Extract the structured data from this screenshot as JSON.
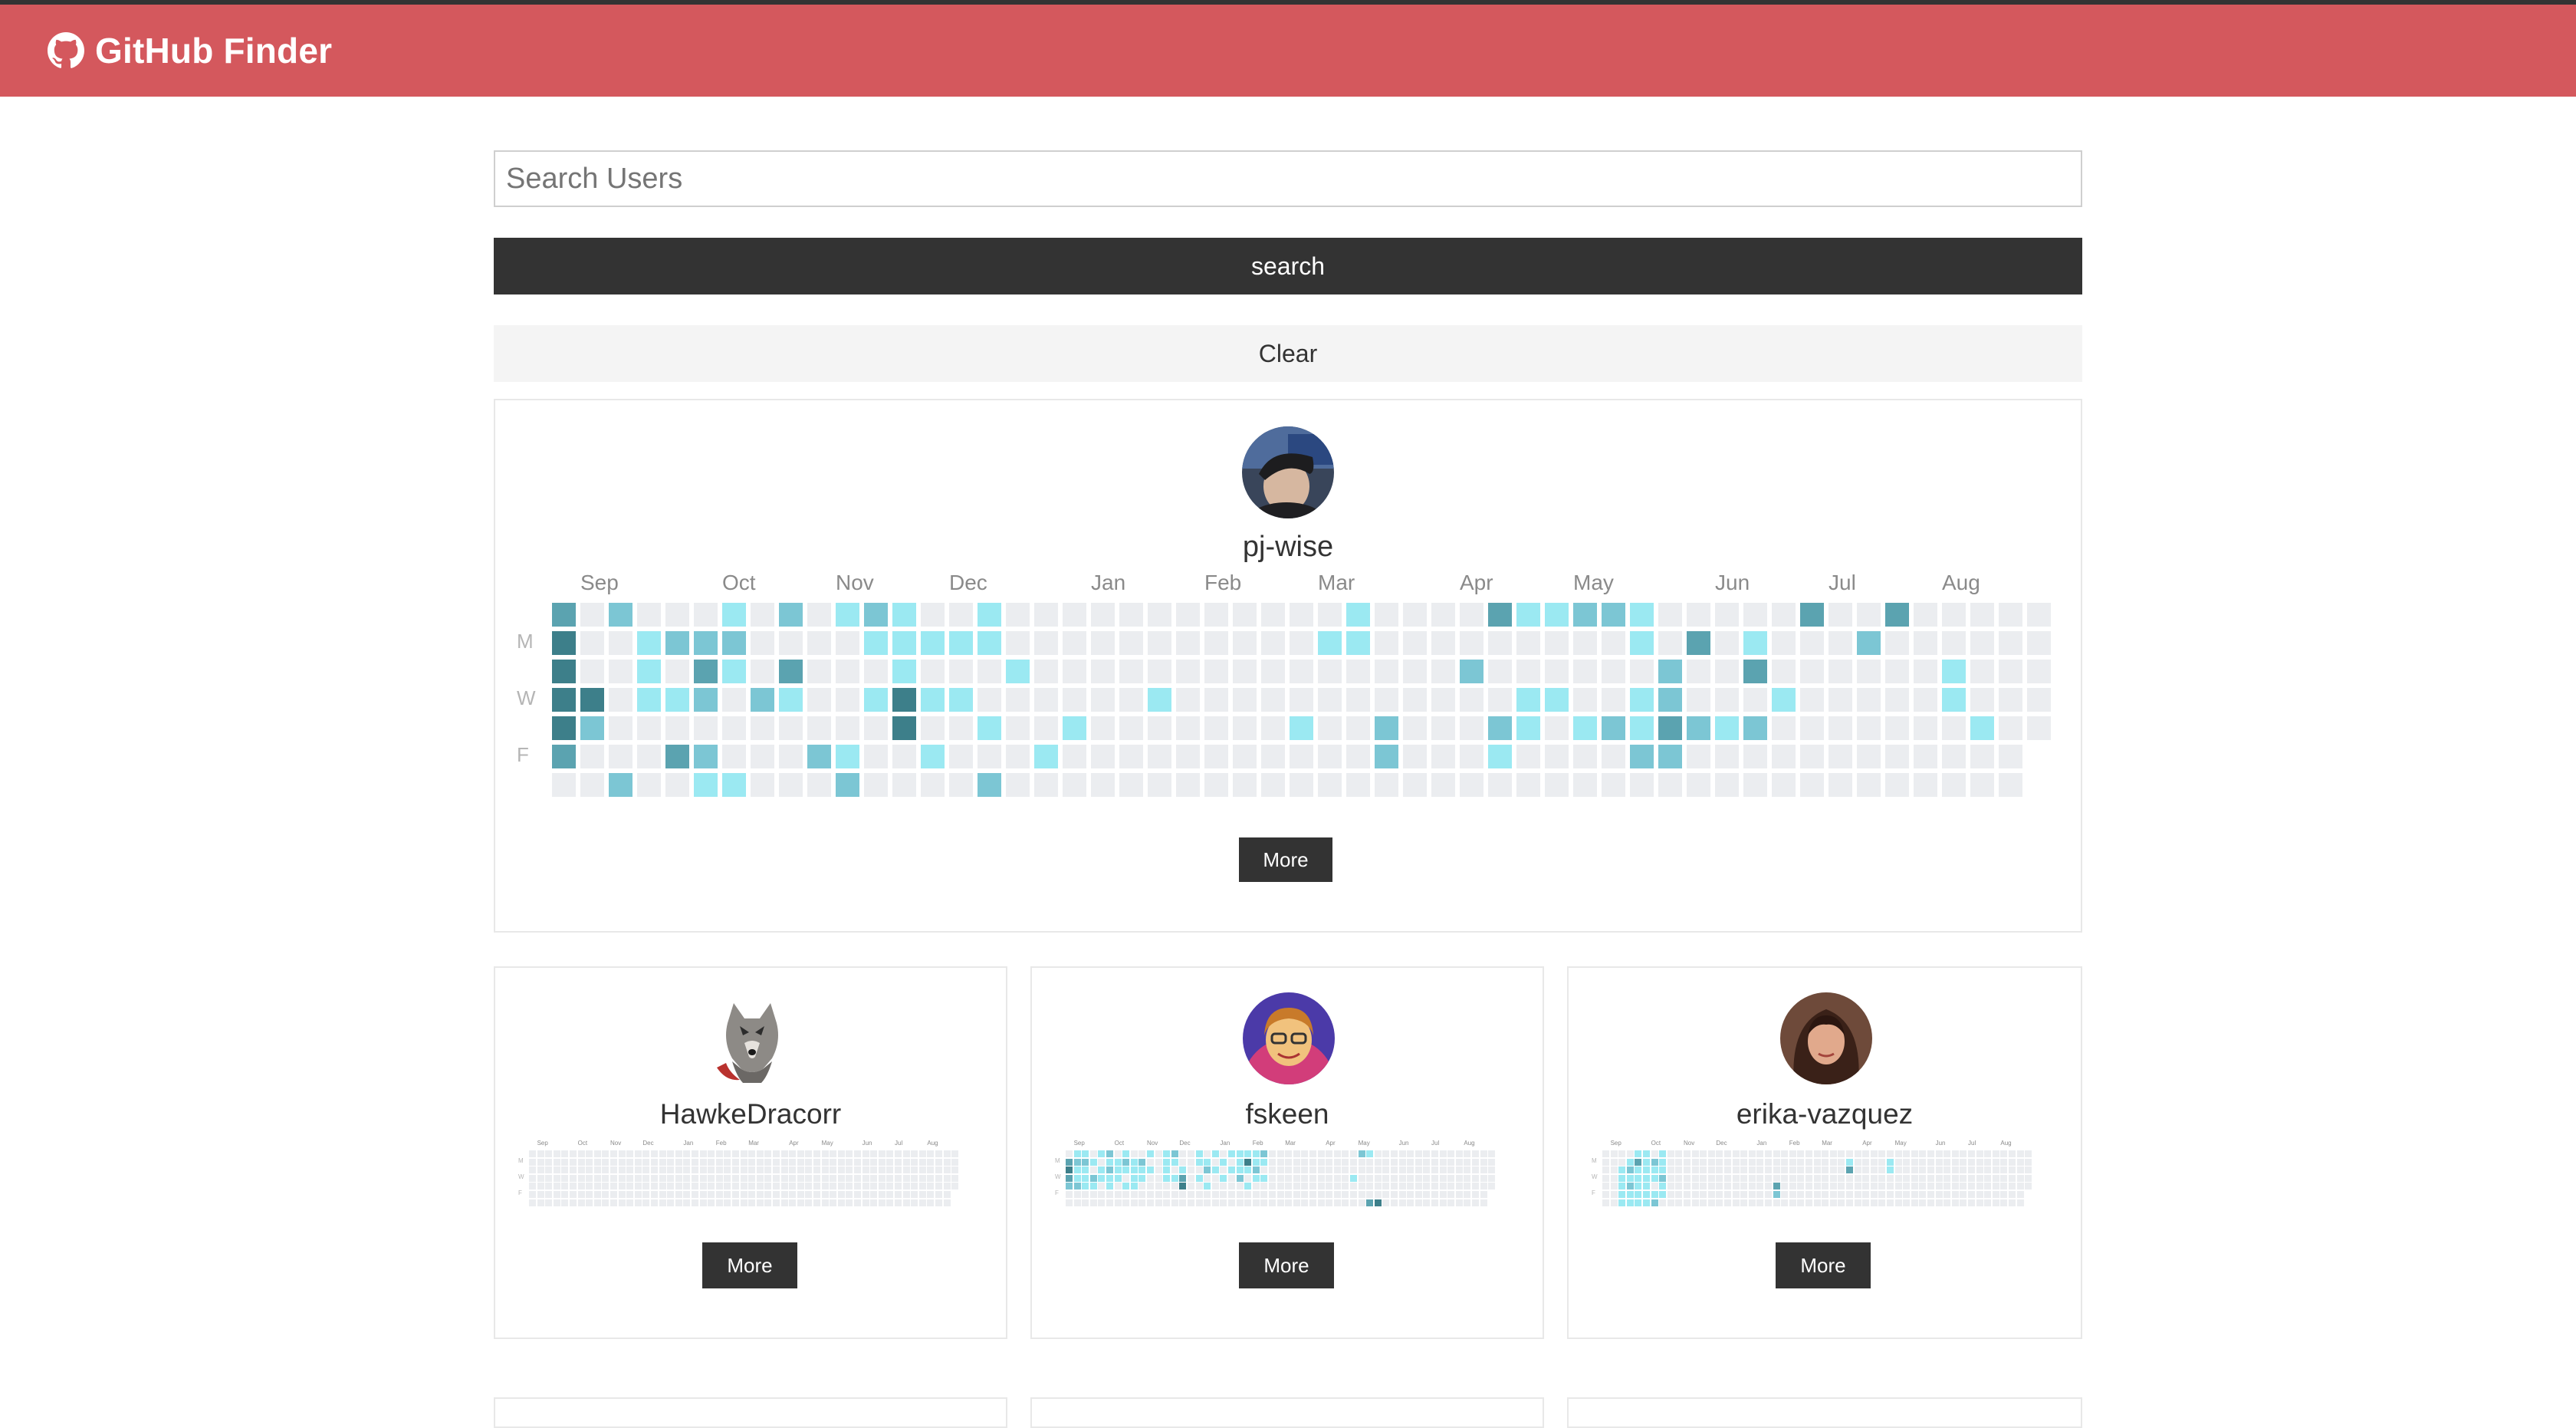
{
  "app": {
    "title": "GitHub Finder",
    "logo_icon": "github-icon",
    "accent": "#d4585d"
  },
  "search": {
    "placeholder": "Search Users",
    "value": "",
    "button_label": "search",
    "clear_label": "Clear"
  },
  "colors": {
    "l0": "#ebedf0",
    "l1": "#9be9f2",
    "l2": "#7cc6d4",
    "l3": "#5ba3b0",
    "l4": "#3d7f8a"
  },
  "day_labels": [
    "M",
    "W",
    "F"
  ],
  "months": [
    "Sep",
    "Oct",
    "Nov",
    "Dec",
    "Jan",
    "Feb",
    "Mar",
    "Apr",
    "May",
    "Jun",
    "Jul",
    "Aug"
  ],
  "featured": {
    "username": "pj-wise",
    "more_label": "More",
    "contributions": {
      "weeks": 53,
      "active": [
        [
          0,
          0,
          3
        ],
        [
          0,
          1,
          4
        ],
        [
          0,
          2,
          4
        ],
        [
          0,
          3,
          4
        ],
        [
          0,
          4,
          4
        ],
        [
          0,
          5,
          3
        ],
        [
          1,
          3,
          4
        ],
        [
          1,
          4,
          2
        ],
        [
          2,
          0,
          2
        ],
        [
          2,
          6,
          2
        ],
        [
          3,
          1,
          1
        ],
        [
          3,
          2,
          1
        ],
        [
          3,
          3,
          1
        ],
        [
          4,
          1,
          2
        ],
        [
          4,
          3,
          1
        ],
        [
          4,
          5,
          3
        ],
        [
          5,
          1,
          2
        ],
        [
          5,
          2,
          3
        ],
        [
          5,
          3,
          2
        ],
        [
          5,
          5,
          2
        ],
        [
          5,
          6,
          1
        ],
        [
          6,
          0,
          1
        ],
        [
          6,
          1,
          2
        ],
        [
          6,
          2,
          1
        ],
        [
          6,
          6,
          1
        ],
        [
          7,
          3,
          2
        ],
        [
          8,
          0,
          2
        ],
        [
          8,
          2,
          3
        ],
        [
          8,
          3,
          1
        ],
        [
          9,
          5,
          2
        ],
        [
          10,
          0,
          1
        ],
        [
          10,
          5,
          1
        ],
        [
          10,
          6,
          2
        ],
        [
          11,
          0,
          2
        ],
        [
          11,
          1,
          1
        ],
        [
          11,
          3,
          1
        ],
        [
          12,
          0,
          1
        ],
        [
          12,
          1,
          1
        ],
        [
          12,
          2,
          1
        ],
        [
          12,
          3,
          4
        ],
        [
          12,
          4,
          4
        ],
        [
          13,
          1,
          1
        ],
        [
          13,
          3,
          1
        ],
        [
          13,
          5,
          1
        ],
        [
          14,
          1,
          1
        ],
        [
          14,
          3,
          1
        ],
        [
          15,
          0,
          1
        ],
        [
          15,
          1,
          1
        ],
        [
          15,
          4,
          1
        ],
        [
          15,
          6,
          2
        ],
        [
          16,
          2,
          1
        ],
        [
          17,
          5,
          1
        ],
        [
          18,
          4,
          1
        ],
        [
          21,
          3,
          1
        ],
        [
          26,
          4,
          1
        ],
        [
          27,
          1,
          1
        ],
        [
          28,
          0,
          1
        ],
        [
          28,
          1,
          1
        ],
        [
          29,
          4,
          2
        ],
        [
          29,
          5,
          2
        ],
        [
          32,
          2,
          2
        ],
        [
          33,
          0,
          3
        ],
        [
          33,
          4,
          2
        ],
        [
          33,
          5,
          1
        ],
        [
          34,
          0,
          1
        ],
        [
          34,
          3,
          1
        ],
        [
          34,
          4,
          1
        ],
        [
          35,
          0,
          1
        ],
        [
          35,
          3,
          1
        ],
        [
          36,
          0,
          2
        ],
        [
          36,
          4,
          1
        ],
        [
          37,
          0,
          2
        ],
        [
          37,
          4,
          2
        ],
        [
          38,
          0,
          1
        ],
        [
          38,
          1,
          1
        ],
        [
          38,
          3,
          1
        ],
        [
          38,
          4,
          1
        ],
        [
          38,
          5,
          2
        ],
        [
          39,
          2,
          2
        ],
        [
          39,
          3,
          2
        ],
        [
          39,
          4,
          3
        ],
        [
          39,
          5,
          2
        ],
        [
          40,
          1,
          3
        ],
        [
          40,
          4,
          2
        ],
        [
          41,
          4,
          1
        ],
        [
          42,
          1,
          1
        ],
        [
          42,
          2,
          3
        ],
        [
          42,
          4,
          2
        ],
        [
          43,
          3,
          1
        ],
        [
          44,
          0,
          3
        ],
        [
          46,
          1,
          2
        ],
        [
          47,
          0,
          3
        ],
        [
          49,
          2,
          1
        ],
        [
          49,
          3,
          1
        ],
        [
          50,
          4,
          1
        ]
      ]
    }
  },
  "users": [
    {
      "username": "HawkeDracorr",
      "more_label": "More",
      "avatar_icon": "wolf-avatar",
      "contributions": {
        "weeks": 53,
        "active": []
      }
    },
    {
      "username": "fskeen",
      "more_label": "More",
      "avatar_icon": "user-avatar",
      "contributions": {
        "weeks": 53,
        "active": [
          [
            0,
            1,
            3
          ],
          [
            0,
            2,
            4
          ],
          [
            0,
            3,
            3
          ],
          [
            0,
            4,
            2
          ],
          [
            1,
            0,
            1
          ],
          [
            1,
            1,
            2
          ],
          [
            1,
            2,
            1
          ],
          [
            1,
            3,
            1
          ],
          [
            1,
            4,
            2
          ],
          [
            2,
            0,
            1
          ],
          [
            2,
            1,
            2
          ],
          [
            2,
            2,
            1
          ],
          [
            2,
            3,
            1
          ],
          [
            2,
            4,
            1
          ],
          [
            3,
            1,
            1
          ],
          [
            3,
            3,
            2
          ],
          [
            3,
            4,
            1
          ],
          [
            4,
            0,
            1
          ],
          [
            4,
            2,
            1
          ],
          [
            4,
            3,
            1
          ],
          [
            5,
            0,
            2
          ],
          [
            5,
            1,
            1
          ],
          [
            5,
            2,
            2
          ],
          [
            5,
            3,
            1
          ],
          [
            5,
            4,
            1
          ],
          [
            6,
            1,
            1
          ],
          [
            6,
            2,
            1
          ],
          [
            6,
            3,
            1
          ],
          [
            7,
            0,
            1
          ],
          [
            7,
            1,
            2
          ],
          [
            7,
            2,
            1
          ],
          [
            7,
            4,
            1
          ],
          [
            8,
            1,
            1
          ],
          [
            8,
            2,
            1
          ],
          [
            8,
            3,
            1
          ],
          [
            8,
            4,
            1
          ],
          [
            9,
            1,
            2
          ],
          [
            9,
            2,
            1
          ],
          [
            9,
            3,
            1
          ],
          [
            10,
            0,
            1
          ],
          [
            10,
            2,
            1
          ],
          [
            12,
            0,
            1
          ],
          [
            12,
            1,
            1
          ],
          [
            12,
            2,
            1
          ],
          [
            12,
            3,
            1
          ],
          [
            13,
            0,
            2
          ],
          [
            13,
            1,
            1
          ],
          [
            13,
            3,
            1
          ],
          [
            14,
            2,
            1
          ],
          [
            14,
            3,
            3
          ],
          [
            14,
            4,
            4
          ],
          [
            16,
            0,
            1
          ],
          [
            16,
            1,
            1
          ],
          [
            16,
            3,
            1
          ],
          [
            17,
            1,
            1
          ],
          [
            17,
            2,
            2
          ],
          [
            17,
            4,
            1
          ],
          [
            18,
            0,
            1
          ],
          [
            18,
            2,
            1
          ],
          [
            19,
            1,
            1
          ],
          [
            19,
            3,
            1
          ],
          [
            20,
            0,
            1
          ],
          [
            20,
            2,
            1
          ],
          [
            21,
            0,
            1
          ],
          [
            21,
            1,
            1
          ],
          [
            21,
            2,
            1
          ],
          [
            21,
            3,
            2
          ],
          [
            22,
            0,
            1
          ],
          [
            22,
            1,
            4
          ],
          [
            22,
            2,
            1
          ],
          [
            22,
            4,
            1
          ],
          [
            23,
            0,
            1
          ],
          [
            23,
            1,
            1
          ],
          [
            23,
            2,
            2
          ],
          [
            23,
            3,
            1
          ],
          [
            24,
            0,
            2
          ],
          [
            24,
            1,
            1
          ],
          [
            24,
            3,
            1
          ],
          [
            35,
            3,
            1
          ],
          [
            36,
            0,
            2
          ],
          [
            37,
            0,
            1
          ],
          [
            37,
            6,
            3
          ],
          [
            38,
            6,
            4
          ]
        ]
      }
    },
    {
      "username": "erika-vazquez",
      "more_label": "More",
      "avatar_icon": "user-avatar",
      "contributions": {
        "weeks": 53,
        "active": [
          [
            2,
            2,
            1
          ],
          [
            2,
            3,
            1
          ],
          [
            2,
            4,
            1
          ],
          [
            2,
            5,
            1
          ],
          [
            2,
            6,
            1
          ],
          [
            3,
            1,
            1
          ],
          [
            3,
            2,
            2
          ],
          [
            3,
            3,
            1
          ],
          [
            3,
            4,
            2
          ],
          [
            3,
            5,
            1
          ],
          [
            3,
            6,
            1
          ],
          [
            4,
            0,
            1
          ],
          [
            4,
            1,
            3
          ],
          [
            4,
            2,
            1
          ],
          [
            4,
            3,
            1
          ],
          [
            4,
            4,
            1
          ],
          [
            4,
            5,
            1
          ],
          [
            4,
            6,
            1
          ],
          [
            5,
            0,
            1
          ],
          [
            5,
            1,
            1
          ],
          [
            5,
            2,
            1
          ],
          [
            5,
            3,
            1
          ],
          [
            5,
            4,
            1
          ],
          [
            5,
            5,
            1
          ],
          [
            5,
            6,
            1
          ],
          [
            6,
            1,
            2
          ],
          [
            6,
            2,
            1
          ],
          [
            6,
            3,
            1
          ],
          [
            6,
            5,
            1
          ],
          [
            6,
            6,
            2
          ],
          [
            7,
            0,
            1
          ],
          [
            7,
            1,
            1
          ],
          [
            7,
            2,
            1
          ],
          [
            7,
            3,
            2
          ],
          [
            7,
            4,
            1
          ],
          [
            7,
            5,
            1
          ],
          [
            21,
            4,
            3
          ],
          [
            21,
            5,
            2
          ],
          [
            30,
            1,
            1
          ],
          [
            30,
            2,
            3
          ],
          [
            35,
            1,
            1
          ],
          [
            35,
            2,
            1
          ]
        ]
      }
    }
  ]
}
